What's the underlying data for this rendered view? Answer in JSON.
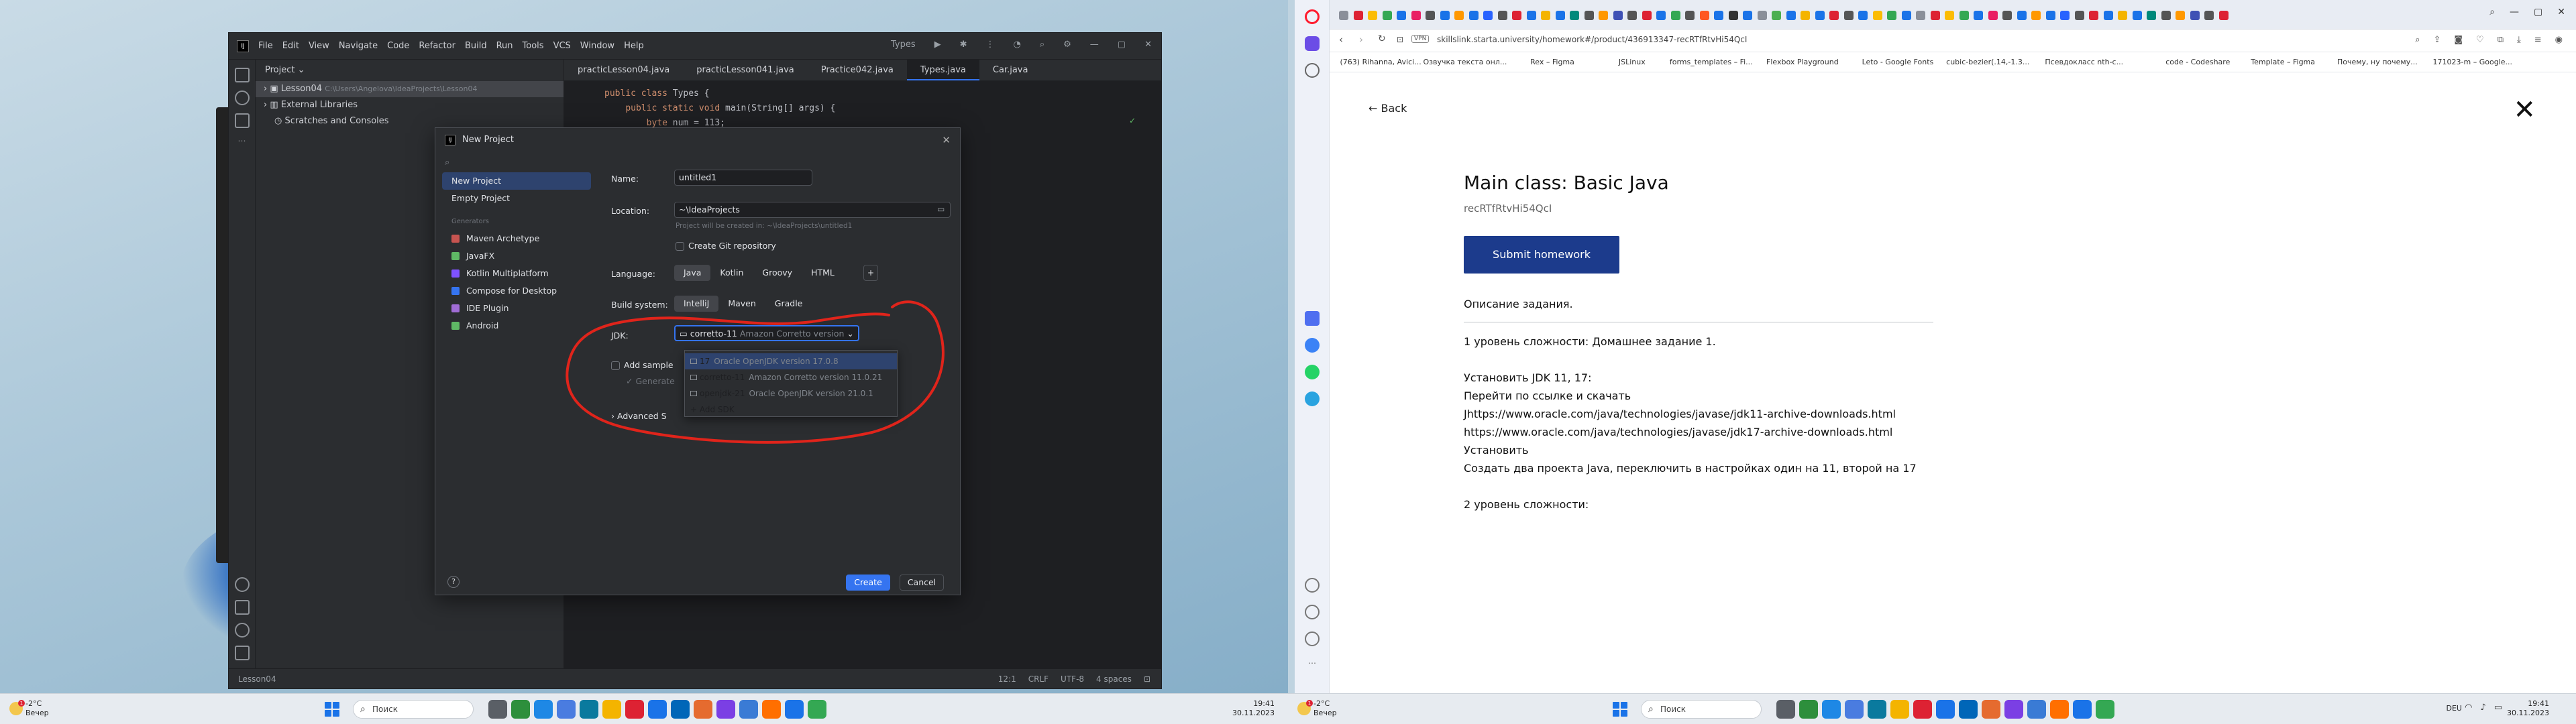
{
  "ide": {
    "menu": [
      "File",
      "Edit",
      "View",
      "Navigate",
      "Code",
      "Refactor",
      "Build",
      "Run",
      "Tools",
      "VCS",
      "Window",
      "Help"
    ],
    "run_config": "Types",
    "project_label": "Project",
    "tree": [
      {
        "label": "Lesson04",
        "path": "C:\\Users\\Angelova\\IdeaProjects\\Lesson04"
      },
      {
        "label": "External Libraries"
      },
      {
        "label": "Scratches and Consoles"
      }
    ],
    "tabs": [
      "practicLesson04.java",
      "practicLesson041.java",
      "Practice042.java",
      "Types.java",
      "Car.java"
    ],
    "active_tab": 3,
    "code": [
      "public class Types {",
      "    public static void main(String[] args) {",
      "        byte num = 113;"
    ],
    "status": {
      "left": "Lesson04",
      "pos": "12:1",
      "crlf": "CRLF",
      "enc": "UTF-8",
      "indent": "4 spaces"
    }
  },
  "dialog": {
    "title": "New Project",
    "nav": [
      "New Project",
      "Empty Project"
    ],
    "generators_caption": "Generators",
    "generators": [
      "Maven Archetype",
      "JavaFX",
      "Kotlin Multiplatform",
      "Compose for Desktop",
      "IDE Plugin",
      "Android"
    ],
    "name_label": "Name:",
    "name_value": "untitled1",
    "location_label": "Location:",
    "location_value": "~\\IdeaProjects",
    "location_hint": "Project will be created in: ~\\IdeaProjects\\untitled1",
    "git_label": "Create Git repository",
    "language_label": "Language:",
    "languages": [
      "Java",
      "Kotlin",
      "Groovy",
      "HTML"
    ],
    "build_label": "Build system:",
    "builds": [
      "IntelliJ",
      "Maven",
      "Gradle"
    ],
    "jdk_label": "JDK:",
    "jdk_value": "corretto-11",
    "jdk_value_meta": "Amazon Corretto version",
    "sample_label": "Add sample",
    "generate_label": "Generate",
    "advanced_label": "Advanced S",
    "jdk_options": [
      {
        "name": "17",
        "meta": "Oracle OpenJDK version 17.0.8"
      },
      {
        "name": "corretto-11",
        "meta": "Amazon Corretto version 11.0.21"
      },
      {
        "name": "openjdk-21",
        "meta": "Oracle OpenJDK version 21.0.1"
      }
    ],
    "add_sdk": "Add SDK",
    "create": "Create",
    "cancel": "Cancel",
    "help": "?"
  },
  "browser": {
    "url": "skillslink.starta.university/homework#/product/436913347-recRTfRtvHi54QcI",
    "vpn": "VPN",
    "bookmarks": [
      "(763) Rihanna, Avici...",
      "Озвучка текста онл...",
      "Rex – Figma",
      "JSLinux",
      "forms_templates – Fi...",
      "Flexbox Playground",
      "Leto - Google Fonts",
      "cubic-bezier(.14,-1.3...",
      "Псевдокласс nth-c...",
      "code - Codeshare",
      "Template – Figma",
      "Почему, ну почему...",
      "171023-m – Google..."
    ],
    "back": "← Back",
    "title": "Main class: Basic Java",
    "record_id": "recRTfRtvHi54QcI",
    "submit": "Submit homework",
    "desc_heading": "Описание задания.",
    "lines": [
      " 1 уровень сложности: Домашнее задание 1.",
      "",
      "Установить JDK 11, 17:",
      "Перейти по ссылке и скачать",
      "Jhttps://www.oracle.com/java/technologies/javase/jdk11-archive-downloads.html",
      "https://www.oracle.com/java/technologies/javase/jdk17-archive-downloads.html",
      "Установить",
      "Создать два проекта Java, переключить в настройках один на 11, второй на 17",
      "",
      "2 уровень сложности:"
    ]
  },
  "taskbar": {
    "left": {
      "temp": "-2°C",
      "weather": "Вечер",
      "time": "19:41",
      "date": "30.11.2023",
      "search": "Поиск"
    },
    "right": {
      "temp": "-2°C",
      "weather": "Вечер",
      "time": "19:41",
      "date": "30.11.2023",
      "search": "Поиск",
      "lang": "DEU"
    },
    "badge": "1"
  },
  "colors": {
    "ij_bg": "#2b2d30",
    "ij_accent": "#3574f0",
    "submit_bg": "#1c3b8c",
    "annotation": "#e0241b"
  }
}
